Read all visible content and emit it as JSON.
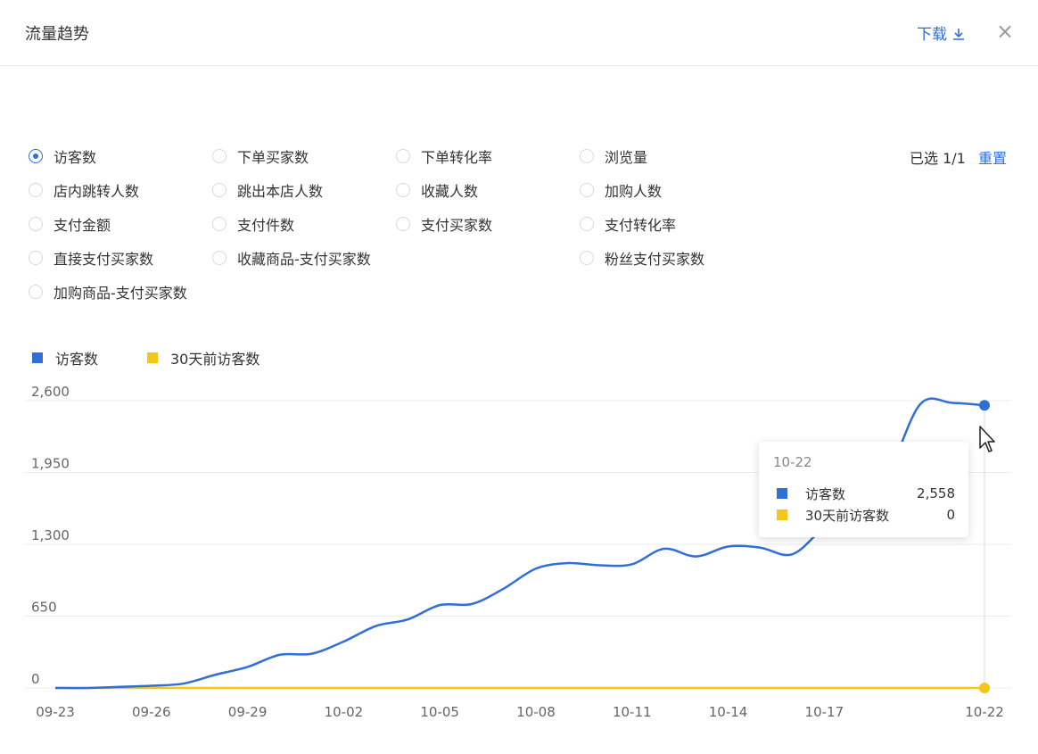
{
  "header": {
    "title": "流量趋势",
    "download_label": "下载",
    "close_label": "×"
  },
  "metrics": [
    {
      "label": "访客数",
      "selected": true
    },
    {
      "label": "下单买家数",
      "selected": false
    },
    {
      "label": "下单转化率",
      "selected": false
    },
    {
      "label": "浏览量",
      "selected": false
    },
    {
      "label": "店内跳转人数",
      "selected": false
    },
    {
      "label": "跳出本店人数",
      "selected": false
    },
    {
      "label": "收藏人数",
      "selected": false
    },
    {
      "label": "加购人数",
      "selected": false
    },
    {
      "label": "支付金额",
      "selected": false
    },
    {
      "label": "支付件数",
      "selected": false
    },
    {
      "label": "支付买家数",
      "selected": false
    },
    {
      "label": "支付转化率",
      "selected": false
    },
    {
      "label": "直接支付买家数",
      "selected": false
    },
    {
      "label": "收藏商品-支付买家数",
      "selected": false
    },
    {
      "label": "粉丝支付买家数",
      "selected": false
    },
    {
      "label": "加购商品-支付买家数",
      "selected": false
    }
  ],
  "selection": {
    "info": "已选 1/1",
    "reset_label": "重置"
  },
  "legend": [
    {
      "label": "访客数",
      "color": "#2f6fd6"
    },
    {
      "label": "30天前访客数",
      "color": "#f5c518"
    }
  ],
  "tooltip": {
    "date": "10-22",
    "rows": [
      {
        "name": "访客数",
        "value": "2,558",
        "color": "#2f6fd6"
      },
      {
        "name": "30天前访客数",
        "value": "0",
        "color": "#f5c518"
      }
    ]
  },
  "chart_data": {
    "type": "line",
    "x": [
      "09-23",
      "09-24",
      "09-25",
      "09-26",
      "09-27",
      "09-28",
      "09-29",
      "09-30",
      "10-01",
      "10-02",
      "10-03",
      "10-04",
      "10-05",
      "10-06",
      "10-07",
      "10-08",
      "10-09",
      "10-10",
      "10-11",
      "10-12",
      "10-13",
      "10-14",
      "10-15",
      "10-16",
      "10-17",
      "10-18",
      "10-19",
      "10-20",
      "10-21",
      "10-22"
    ],
    "x_tick_labels": [
      "09-23",
      "09-26",
      "09-29",
      "10-02",
      "10-05",
      "10-08",
      "10-11",
      "10-14",
      "10-17",
      "10-22"
    ],
    "y_ticks": [
      "2,600",
      "1,950",
      "1,300",
      "650",
      "0"
    ],
    "ylim": [
      0,
      2600
    ],
    "grid": true,
    "legend_position": "top-left",
    "series": [
      {
        "name": "访客数",
        "color": "#2f6fd6",
        "values": [
          0,
          0,
          10,
          20,
          40,
          120,
          190,
          300,
          310,
          420,
          560,
          620,
          750,
          760,
          900,
          1080,
          1130,
          1110,
          1120,
          1260,
          1190,
          1280,
          1270,
          1210,
          1460,
          1710,
          1960,
          2570,
          2580,
          2558
        ]
      },
      {
        "name": "30天前访客数",
        "color": "#f5c518",
        "values": [
          0,
          0,
          0,
          0,
          0,
          0,
          0,
          0,
          0,
          0,
          0,
          0,
          0,
          0,
          0,
          0,
          0,
          0,
          0,
          0,
          0,
          0,
          0,
          0,
          0,
          0,
          0,
          0,
          0,
          0
        ]
      }
    ]
  }
}
